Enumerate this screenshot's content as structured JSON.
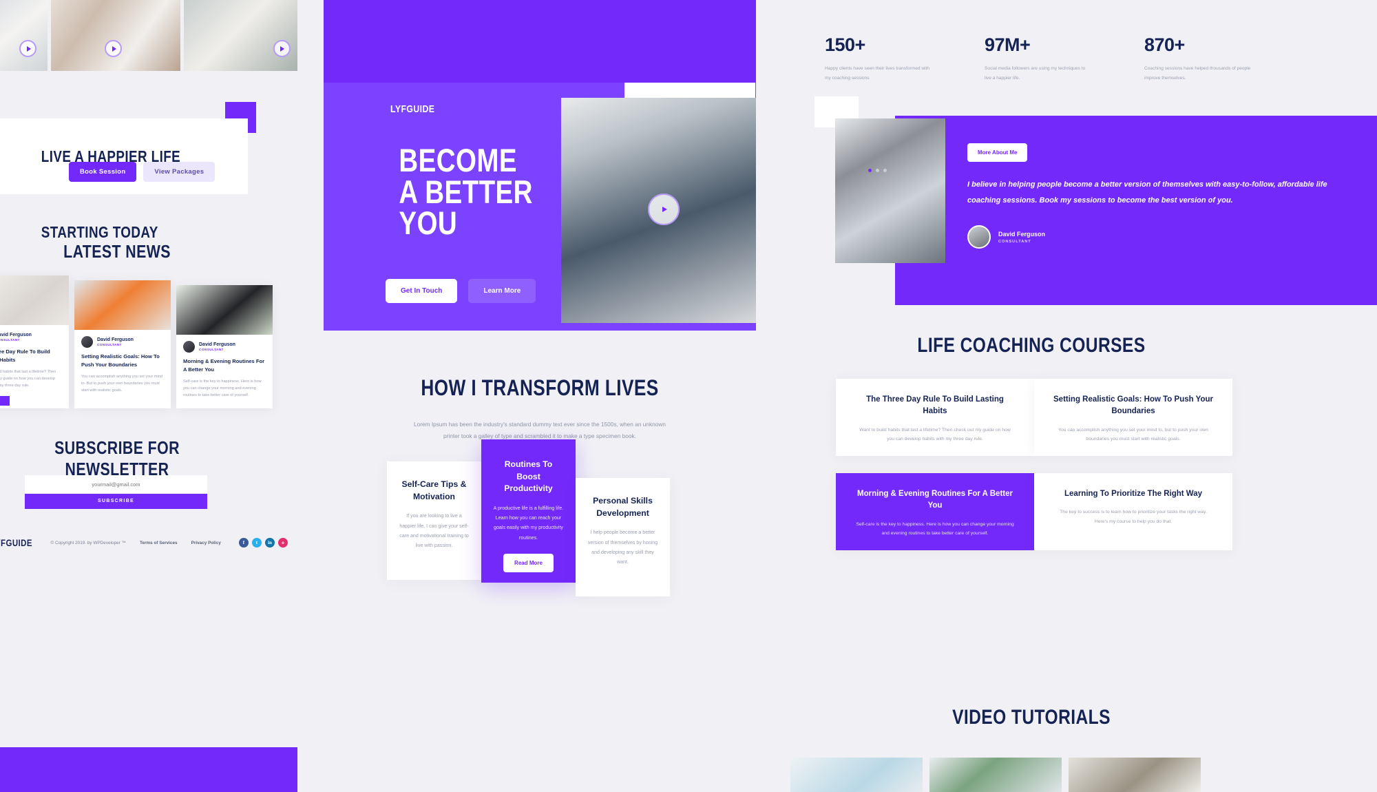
{
  "brand": {
    "accent": "#7429fb",
    "accent_light": "#7b42ff",
    "navy": "#152354"
  },
  "left_panel": {
    "cta": {
      "title": "LIVE A HAPPIER LIFE STARTING TODAY",
      "primary_button": "Book Session",
      "secondary_button": "View Packages"
    },
    "latest_news_title": "LATEST NEWS",
    "news": [
      {
        "author": "David Ferguson",
        "role": "CONSULTANT",
        "title": "The Three Day Rule To Build Lasting Habits",
        "desc": "Want to build habits that last a lifetime? Then check out my guide on how you can develop habits with my three day rule."
      },
      {
        "author": "David Ferguson",
        "role": "CONSULTANT",
        "title": "Setting Realistic Goals: How To Push Your Boundaries",
        "desc": "You can accomplish anything you set your mind to. But to push your own boundaries you must start with realistic goals."
      },
      {
        "author": "David Ferguson",
        "role": "CONSULTANT",
        "title": "Morning & Evening Routines For A Better You",
        "desc": "Self-care is the key to happiness. Here is how you can change your morning and evening routines to take better care of yourself."
      }
    ],
    "newsletter": {
      "title": "SUBSCRIBE FOR NEWSLETTER",
      "placeholder": "yourmail@gmail.com",
      "button": "SUBSCRIBE"
    },
    "footer": {
      "logo": "LYFGUIDE",
      "copyright": "© Copyright 2019. by WPDeveloper ™",
      "links": [
        "Terms of Services",
        "Privacy Policy"
      ],
      "socials": [
        "facebook-icon",
        "twitter-icon",
        "linkedin-icon",
        "instagram-icon"
      ],
      "social_glyphs": [
        "f",
        "t",
        "in",
        "o"
      ]
    }
  },
  "center_panel": {
    "hero": {
      "logo": "LYFGUIDE",
      "heading_lines": [
        "BECOME",
        "A BETTER",
        "YOU"
      ],
      "primary_button": "Get In Touch",
      "secondary_button": "Learn More"
    },
    "transform": {
      "title": "HOW I TRANSFORM LIVES",
      "subtitle": "Lorem Ipsum has been the industry's standard dummy text ever since the 1500s, when an unknown printer took a galley of type and scrambled it to make a type specimen book."
    },
    "features": [
      {
        "title": "Self-Care Tips & Motivation",
        "desc": "If you are looking to live a happier life, I can give your self-care and motivational training to live with passion.",
        "button": ""
      },
      {
        "title": "Routines To Boost Productivity",
        "desc": "A productive life is a fulfilling life. Learn how you can reach your goals easily with my productivity routines.",
        "button": "Read More"
      },
      {
        "title": "Personal Skills Development",
        "desc": "I help people become a better version of themselves by honing and developing any skill they want.",
        "button": ""
      }
    ]
  },
  "right_panel": {
    "stats": [
      {
        "number": "150+",
        "desc": "Happy clients have seen their lives transformed with my coaching sessions"
      },
      {
        "number": "97M+",
        "desc": "Social media followers are using my techniques to live a happier life."
      },
      {
        "number": "870+",
        "desc": "Coaching sessions have helped thousands of people improve themselves."
      }
    ],
    "about": {
      "button": "More About Me",
      "quote": "I believe in helping people become a better version of themselves with easy-to-follow, affordable life coaching sessions. Book my sessions to become the best version of you.",
      "name": "David Ferguson",
      "role": "CONSULTANT"
    },
    "courses_title": "LIFE COACHING COURSES",
    "courses": [
      {
        "title": "The Three Day Rule To Build Lasting Habits",
        "desc": "Want to build habits that last a lifetime? Then check out my guide on how you can develop habits with my three day rule."
      },
      {
        "title": "Setting Realistic Goals: How To Push Your Boundaries",
        "desc": "You can accomplish anything you set your mind to, but to push your own boundaries you must start with realistic goals."
      },
      {
        "title": "Morning & Evening Routines For A Better You",
        "desc": "Self-care is the key to happiness. Here is how you can change your morning and evening routines to take better care of yourself."
      },
      {
        "title": "Learning To Prioritize The Right Way",
        "desc": "The key to success is to learn how to prioritize your tasks the right way. Here's my course to help you do that."
      }
    ],
    "video_title": "VIDEO TUTORIALS"
  }
}
